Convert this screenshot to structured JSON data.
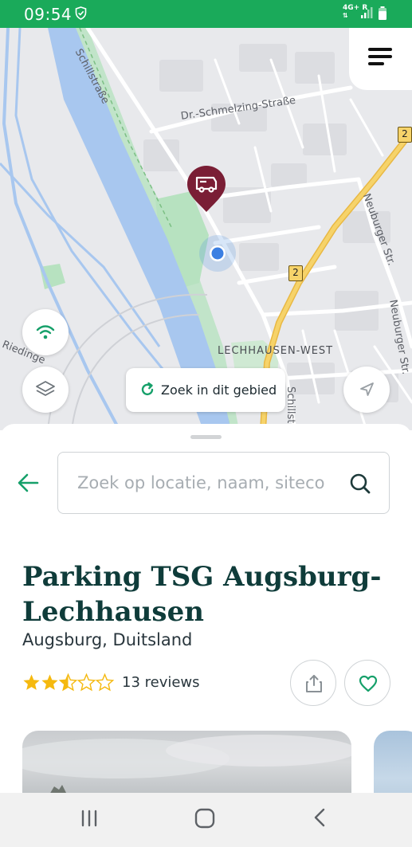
{
  "status_bar": {
    "time": "09:54",
    "network": "4G+",
    "roaming": "R"
  },
  "map": {
    "labels": {
      "schillstrasse_top": "Schillstraße",
      "schmelzing": "Dr.-Schmelzing-Straße",
      "neuburger_1": "Neuburger Str.",
      "neuburger_2": "Neuburger Str.",
      "lechhausen": "LECHHAUSEN-WEST",
      "riedinger": "Riedinge",
      "schillst_bottom": "Schillst",
      "route_1": "2",
      "route_2": "2"
    },
    "search_area_label": "Zoek in dit gebied"
  },
  "search": {
    "placeholder": "Zoek op locatie, naam, siteco",
    "value": ""
  },
  "place": {
    "name": "Parking TSG Augsburg-Lechhausen",
    "location": "Augsburg, Duitsland",
    "rating": 2.5,
    "rating_max": 5,
    "reviews_label": "13 reviews"
  },
  "colors": {
    "brand_green": "#1aaa5a",
    "accent_green": "#16a06a",
    "pin_color": "#7a1e35",
    "title_color": "#0f3c3a",
    "star_color": "#f5b90f"
  },
  "icons": {
    "menu": "hamburger-menu-icon",
    "wifi": "wifi-icon",
    "layers": "layers-icon",
    "locate": "navigation-arrow-icon",
    "refresh": "refresh-icon",
    "back": "arrow-left-icon",
    "search": "search-icon",
    "share": "share-icon",
    "favorite": "heart-icon"
  }
}
